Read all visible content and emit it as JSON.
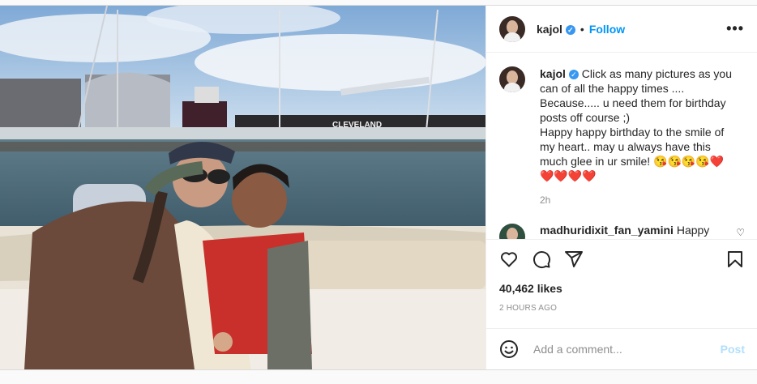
{
  "header": {
    "username": "kajol",
    "separator": "•",
    "follow_label": "Follow",
    "more_label": "•••"
  },
  "caption": {
    "username": "kajol",
    "lines": [
      "Click as many pictures as you",
      "can of all the happy times ....",
      "Because..... u need them for birthday",
      "posts off course ;)",
      "Happy happy birthday to the smile of",
      "my heart.. may u always have this",
      "much glee in ur smile! 😘😘😘😘❤️",
      "❤️❤️❤️❤️"
    ],
    "time": "2h"
  },
  "comment": {
    "username": "madhuridixit_fan_yamini",
    "text": "Happy"
  },
  "photo": {
    "sign_text": "CLEVELAND"
  },
  "stats": {
    "likes": "40,462 likes",
    "posted_ago": "2 HOURS AGO"
  },
  "add_comment": {
    "placeholder": "Add a comment...",
    "post_label": "Post"
  },
  "icons": [
    "heart-icon",
    "comment-icon",
    "share-icon",
    "bookmark-icon",
    "emoji-icon",
    "verified-icon"
  ]
}
